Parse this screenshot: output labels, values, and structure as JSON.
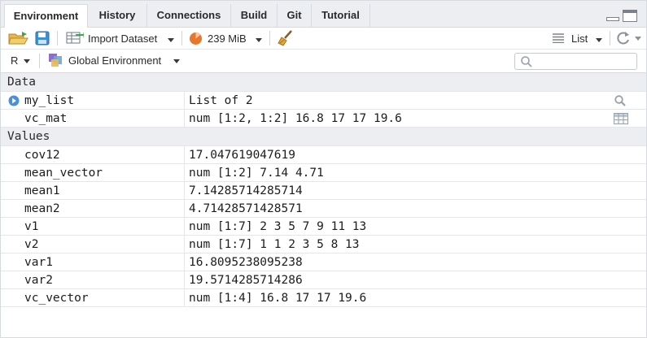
{
  "tabs": [
    "Environment",
    "History",
    "Connections",
    "Build",
    "Git",
    "Tutorial"
  ],
  "toolbar": {
    "import_label": "Import Dataset",
    "memory_label": "239 MiB",
    "view_mode_label": "List"
  },
  "env": {
    "language_label": "R",
    "scope_label": "Global Environment",
    "search_placeholder": ""
  },
  "sections": {
    "data_header": "Data",
    "values_header": "Values"
  },
  "data_rows": [
    {
      "name": "my_list",
      "value": "List of  2",
      "action_icon": "search-icon",
      "expand_icon": "expand-arrow-icon"
    },
    {
      "name": "vc_mat",
      "value": "num [1:2, 1:2] 16.8 17 17 19.6",
      "action_icon": "table-view-icon"
    }
  ],
  "value_rows": [
    {
      "name": "cov12",
      "value": "17.047619047619"
    },
    {
      "name": "mean_vector",
      "value": "num [1:2] 7.14 4.71"
    },
    {
      "name": "mean1",
      "value": "7.14285714285714"
    },
    {
      "name": "mean2",
      "value": "4.71428571428571"
    },
    {
      "name": "v1",
      "value": "num [1:7] 2 3 5 7 9 11 13"
    },
    {
      "name": "v2",
      "value": "num [1:7] 1 1 2 3 5 8 13"
    },
    {
      "name": "var1",
      "value": "16.8095238095238"
    },
    {
      "name": "var2",
      "value": "19.5714285714286"
    },
    {
      "name": "vc_vector",
      "value": "num [1:4] 16.8 17 17 19.6"
    }
  ],
  "colors": {
    "accent_blue": "#4a90d9",
    "memory_orange": "#e8762b",
    "tab_bg": "#eceef1",
    "border": "#d6dbe0"
  }
}
